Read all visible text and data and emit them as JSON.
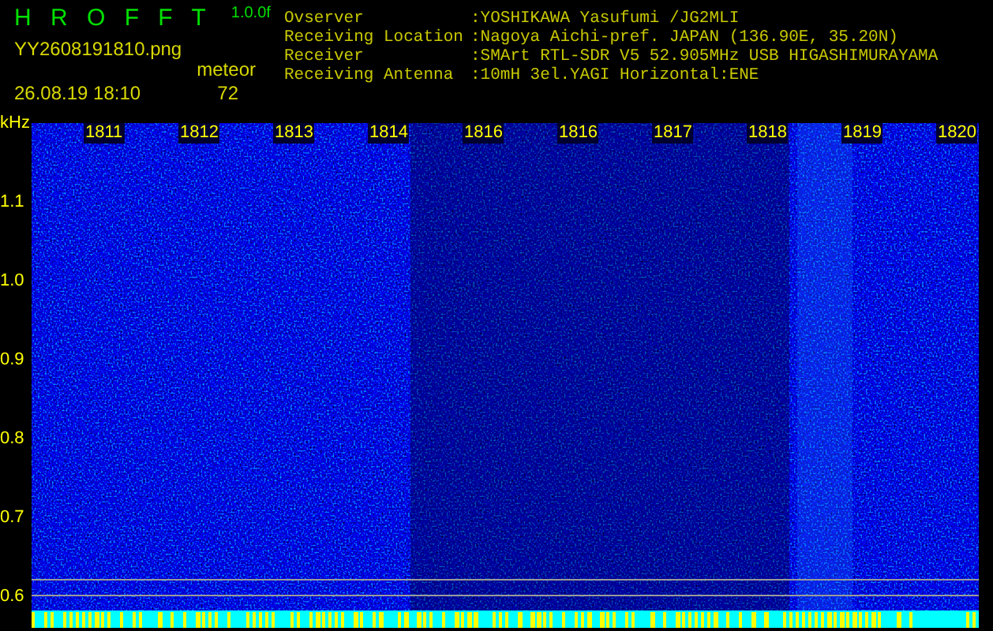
{
  "header": {
    "title": "H R O F F T",
    "version": "1.0.0f",
    "filename": "YY2608191810.png",
    "timestamp": "26.08.19 18:10",
    "category": "meteor",
    "count": "72"
  },
  "info": [
    {
      "label": "Ovserver",
      "value": ":YOSHIKAWA Yasufumi /JG2MLI"
    },
    {
      "label": "Receiving Location",
      "value": ":Nagoya Aichi-pref. JAPAN (136.90E, 35.20N)"
    },
    {
      "label": "Receiver",
      "value": ":SMArt RTL-SDR V5 52.905MHz USB HIGASHIMURAYAMA"
    },
    {
      "label": "Receiving Antenna",
      "value": ":10mH 3el.YAGI Horizontal:ENE"
    }
  ],
  "y_axis": {
    "unit": "kHz",
    "labels": [
      "1.1",
      "1.0",
      "0.9",
      "0.8",
      "0.7",
      "0.6"
    ]
  },
  "time_labels": [
    "1811",
    "1812",
    "1813",
    "1814",
    "1816",
    "1816",
    "1817",
    "1818",
    "1819",
    "1820"
  ]
}
